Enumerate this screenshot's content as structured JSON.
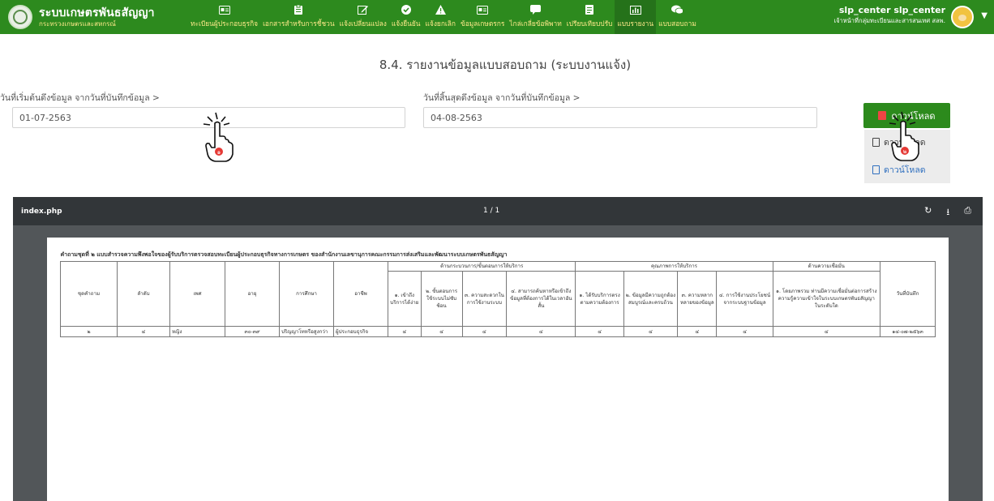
{
  "app": {
    "title": "ระบบเกษตรพันธสัญญา",
    "subtitle": "กระทรวงเกษตรและสหกรณ์"
  },
  "nav": [
    {
      "label": "ทะเบียนผู้ประกอบธุรกิจ",
      "icon": "id-card-icon"
    },
    {
      "label": "เอกสารสำหรับการชี้ชวน",
      "icon": "document-icon"
    },
    {
      "label": "แจ้งเปลี่ยนแปลง",
      "icon": "edit-icon"
    },
    {
      "label": "แจ้งยืนยัน",
      "icon": "check-circle-icon"
    },
    {
      "label": "แจ้งยกเลิก",
      "icon": "warning-icon"
    },
    {
      "label": "ข้อมูลเกษตรกร",
      "icon": "id-card-icon"
    },
    {
      "label": "ไกล่เกลี่ยข้อพิพาท",
      "icon": "chat-bubble-icon"
    },
    {
      "label": "เปรียบเทียบปรับ",
      "icon": "clipboard-icon"
    },
    {
      "label": "แบบรายงาน",
      "icon": "bar-chart-icon"
    },
    {
      "label": "แบบสอบถาม",
      "icon": "comments-icon"
    }
  ],
  "user": {
    "name": "slp_center slp_center",
    "role": "เจ้าหน้าที่กลุ่มทะเบียนและสารสนเทศ สลพ."
  },
  "page_title": "8.4. รายงานข้อมูลแบบสอบถาม (ระบบงานแจ้ง)",
  "form": {
    "start_label": "วันที่เริ่มต้นดึงข้อมูล จากวันที่บันทึกข้อมูล >",
    "start_value": "01-07-2563",
    "end_label": "วันที่สิ้นสุดดึงข้อมูล จากวันที่บันทึกข้อมูล >",
    "end_value": "04-08-2563"
  },
  "download": {
    "main_label": "ดาวน์โหลด",
    "items": [
      "ดาวน์โหลด",
      "ดาวน์โหลด"
    ]
  },
  "annotations": {
    "step1": "๑",
    "step2": "๒"
  },
  "viewer": {
    "filename": "index.php",
    "pages": "1 / 1"
  },
  "report": {
    "title": "คำถามชุดที่ ๒ แบบสำรวจความพึงพอใจของผู้รับบริการตรวจสอบทะเบียนผู้ประกอบธุรกิจทางการเกษตร ของสำนักงานเลขานุการคณะกรรมการส่งเสริมและพัฒนาระบบเกษตรพันธสัญญา",
    "groups": {
      "process": "ด้านกระบวนการ/ขั้นตอนการให้บริการ",
      "quality": "คุณภาพการให้บริการ",
      "trust": "ด้านความเชื่อมั่น"
    },
    "columns": {
      "set": "ชุดคำถาม",
      "no": "ลำดับ",
      "sex": "เพศ",
      "age": "อายุ",
      "edu": "การศึกษา",
      "job": "อาชีพ",
      "p1": "๑. เข้าถึงบริการได้ง่าย",
      "p2": "๒. ขั้นตอนการใช้ระบบไม่ซับซ้อน",
      "p3": "๓. ความสะดวกในการใช้งานระบบ",
      "p4": "๔. สามารถค้นหาหรือเข้าถึงข้อมูลที่ต้องการได้ในเวลาอันสั้น",
      "q1": "๑. ได้รับบริการตรงตามความต้องการ",
      "q2": "๒. ข้อมูลมีความถูกต้องสมบูรณ์และครบถ้วน",
      "q3": "๓. ความหลากหลายของข้อมูล",
      "q4": "๔. การใช้งานประโยชน์จากระบบฐานข้อมูล",
      "t1": "๑. โดยภาพรวม ท่านมีความเชื่อมั่นต่อการสร้างความรู้ความเข้าใจในระบบเกษตรพันธสัญญา ในระดับใด",
      "date": "วันที่บันทึก"
    },
    "rows": [
      {
        "set": "๒",
        "no": "๔",
        "sex": "หญิง",
        "age": "๓๐-๓๙",
        "edu": "ปริญญาโทหรือสูงกว่า",
        "job": "ผู้ประกอบธุรกิจ",
        "p1": "๔",
        "p2": "๔",
        "p3": "๔",
        "p4": "๔",
        "q1": "๔",
        "q2": "๔",
        "q3": "๔",
        "q4": "๔",
        "t1": "๔",
        "date": "๑๔-๐๗-๒๕๖๓"
      }
    ]
  }
}
